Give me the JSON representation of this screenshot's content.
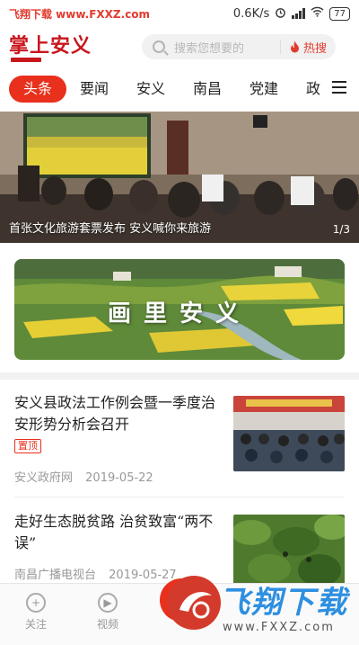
{
  "status_bar": {
    "watermark": "飞翔下载 www.FXXZ.com",
    "speed": "0.6K/s",
    "battery": "77",
    "icons": [
      "alarm-icon",
      "signal-icon",
      "wifi-icon",
      "battery-icon"
    ]
  },
  "header": {
    "logo_text": "掌上安义",
    "search_placeholder": "搜索您想要的",
    "hot_label": "热搜"
  },
  "tabs": [
    {
      "label": "头条",
      "active": true
    },
    {
      "label": "要闻",
      "active": false
    },
    {
      "label": "安义",
      "active": false
    },
    {
      "label": "南昌",
      "active": false
    },
    {
      "label": "党建",
      "active": false
    },
    {
      "label": "政",
      "active": false
    }
  ],
  "banner": {
    "caption": "首张文化旅游套票发布 安义喊你来旅游",
    "index": "1/3"
  },
  "promo": {
    "title": "画里安义"
  },
  "news": [
    {
      "title": "安义县政法工作例会暨一季度治安形势分析会召开",
      "badge": "置顶",
      "source": "安义政府网",
      "date": "2019-05-22"
    },
    {
      "title": "走好生态脱贫路 治贫致富“两不误”",
      "badge": "",
      "source": "南昌广播电视台",
      "date": "2019-05-27"
    }
  ],
  "bottom_nav": {
    "items": [
      {
        "label": "关注",
        "icon": "follow-icon"
      },
      {
        "label": "视频",
        "icon": "video-icon"
      }
    ]
  },
  "watermark": {
    "title": "飞翔下载",
    "url": "www.FXXZ.com"
  },
  "colors": {
    "accent": "#e8301c",
    "logo": "#c8161d",
    "watermark_blue": "#2e8fe0"
  }
}
